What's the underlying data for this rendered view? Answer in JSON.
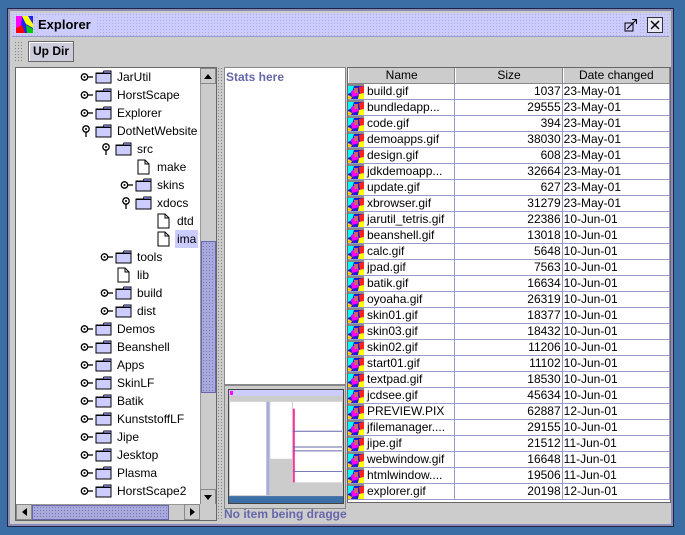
{
  "window": {
    "title": "Explorer",
    "icon": "app-explorer-icon",
    "buttons": {
      "maximize": "maximize-icon",
      "close": "close-icon"
    }
  },
  "toolbar": {
    "up_dir_label": "Up Dir"
  },
  "tree": {
    "nodes": [
      {
        "label": "JarUtil",
        "type": "folder",
        "depth": 0,
        "expanded": false
      },
      {
        "label": "HorstScape",
        "type": "folder",
        "depth": 0,
        "expanded": false
      },
      {
        "label": "Explorer",
        "type": "folder",
        "depth": 0,
        "expanded": false
      },
      {
        "label": "DotNetWebsite",
        "type": "folder",
        "depth": 0,
        "expanded": true
      },
      {
        "label": "src",
        "type": "folder",
        "depth": 1,
        "expanded": true
      },
      {
        "label": "make",
        "type": "file",
        "depth": 2
      },
      {
        "label": "skins",
        "type": "folder",
        "depth": 2,
        "expanded": false
      },
      {
        "label": "xdocs",
        "type": "folder",
        "depth": 2,
        "expanded": true
      },
      {
        "label": "dtd",
        "type": "file",
        "depth": 3
      },
      {
        "label": "ima",
        "type": "file",
        "depth": 3,
        "selected": true
      },
      {
        "label": "tools",
        "type": "folder",
        "depth": 1,
        "expanded": false
      },
      {
        "label": "lib",
        "type": "file",
        "depth": 1
      },
      {
        "label": "build",
        "type": "folder",
        "depth": 1,
        "expanded": false
      },
      {
        "label": "dist",
        "type": "folder",
        "depth": 1,
        "expanded": false
      },
      {
        "label": "Demos",
        "type": "folder",
        "depth": 0,
        "expanded": false
      },
      {
        "label": "Beanshell",
        "type": "folder",
        "depth": 0,
        "expanded": false
      },
      {
        "label": "Apps",
        "type": "folder",
        "depth": 0,
        "expanded": false
      },
      {
        "label": "SkinLF",
        "type": "folder",
        "depth": 0,
        "expanded": false
      },
      {
        "label": "Batik",
        "type": "folder",
        "depth": 0,
        "expanded": false
      },
      {
        "label": "KunststoffLF",
        "type": "folder",
        "depth": 0,
        "expanded": false
      },
      {
        "label": "Jipe",
        "type": "folder",
        "depth": 0,
        "expanded": false
      },
      {
        "label": "Jesktop",
        "type": "folder",
        "depth": 0,
        "expanded": false
      },
      {
        "label": "Plasma",
        "type": "folder",
        "depth": 0,
        "expanded": false
      },
      {
        "label": "HorstScape2",
        "type": "folder",
        "depth": 0,
        "expanded": false
      }
    ]
  },
  "stats": {
    "text": "Stats here"
  },
  "status": {
    "drag_text": "No item being dragged"
  },
  "table": {
    "columns": [
      "Name",
      "Size",
      "Date changed"
    ],
    "rows": [
      {
        "name": "build.gif",
        "size": "1037",
        "date": "23-May-01"
      },
      {
        "name": "bundledapp...",
        "size": "29555",
        "date": "23-May-01"
      },
      {
        "name": "code.gif",
        "size": "394",
        "date": "23-May-01"
      },
      {
        "name": "demoapps.gif",
        "size": "38030",
        "date": "23-May-01"
      },
      {
        "name": "design.gif",
        "size": "608",
        "date": "23-May-01"
      },
      {
        "name": "jdkdemoapp...",
        "size": "32664",
        "date": "23-May-01"
      },
      {
        "name": "update.gif",
        "size": "627",
        "date": "23-May-01"
      },
      {
        "name": "xbrowser.gif",
        "size": "31279",
        "date": "23-May-01"
      },
      {
        "name": "jarutil_tetris.gif",
        "size": "22386",
        "date": "10-Jun-01"
      },
      {
        "name": "beanshell.gif",
        "size": "13018",
        "date": "10-Jun-01"
      },
      {
        "name": "calc.gif",
        "size": "5648",
        "date": "10-Jun-01"
      },
      {
        "name": "jpad.gif",
        "size": "7563",
        "date": "10-Jun-01"
      },
      {
        "name": "batik.gif",
        "size": "16634",
        "date": "10-Jun-01"
      },
      {
        "name": "oyoaha.gif",
        "size": "26319",
        "date": "10-Jun-01"
      },
      {
        "name": "skin01.gif",
        "size": "18377",
        "date": "10-Jun-01"
      },
      {
        "name": "skin03.gif",
        "size": "18432",
        "date": "10-Jun-01"
      },
      {
        "name": "skin02.gif",
        "size": "11206",
        "date": "10-Jun-01"
      },
      {
        "name": "start01.gif",
        "size": "11102",
        "date": "10-Jun-01"
      },
      {
        "name": "textpad.gif",
        "size": "18530",
        "date": "10-Jun-01"
      },
      {
        "name": "jcdsee.gif",
        "size": "45634",
        "date": "10-Jun-01"
      },
      {
        "name": "PREVIEW.PIX",
        "size": "62887",
        "date": "12-Jun-01"
      },
      {
        "name": "jfilemanager....",
        "size": "29155",
        "date": "10-Jun-01"
      },
      {
        "name": "jipe.gif",
        "size": "21512",
        "date": "11-Jun-01"
      },
      {
        "name": "webwindow.gif",
        "size": "16648",
        "date": "11-Jun-01"
      },
      {
        "name": "htmlwindow....",
        "size": "19506",
        "date": "11-Jun-01"
      },
      {
        "name": "explorer.gif",
        "size": "20198",
        "date": "12-Jun-01"
      }
    ]
  },
  "colors": {
    "desktop": "#3a6ea5",
    "accent": "#ccccff",
    "scroll_thumb": "#aaaadd",
    "status_text": "#6666aa"
  }
}
